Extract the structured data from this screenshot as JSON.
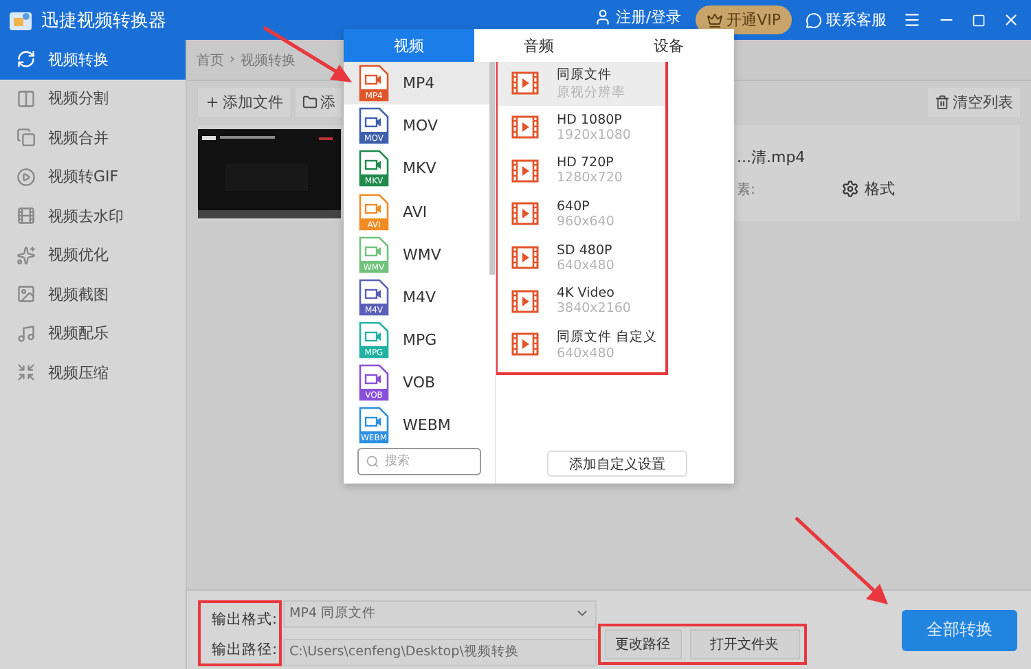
{
  "window": {
    "title": "迅捷视频转换器"
  },
  "header_actions": {
    "login": "注册/登录",
    "vip": "开通VIP",
    "support": "联系客服"
  },
  "sidebar": {
    "items": [
      {
        "label": "视频转换",
        "selected": true
      },
      {
        "label": "视频分割",
        "selected": false
      },
      {
        "label": "视频合并",
        "selected": false
      },
      {
        "label": "视频转GIF",
        "selected": false
      },
      {
        "label": "视频去水印",
        "selected": false
      },
      {
        "label": "视频优化",
        "selected": false
      },
      {
        "label": "视频截图",
        "selected": false
      },
      {
        "label": "视频配乐",
        "selected": false
      },
      {
        "label": "视频压缩",
        "selected": false
      }
    ]
  },
  "breadcrumb": [
    "首页",
    "视频转换"
  ],
  "breadcrumb_separator": "›",
  "toolbar": {
    "add_file": "添加文件",
    "add_folder": "添",
    "clear": "清空列表"
  },
  "file": {
    "name": "...清.mp4",
    "info": "素:",
    "format": "格式"
  },
  "format_popup": {
    "tabs": [
      {
        "label": "视频",
        "selected": true
      },
      {
        "label": "音频",
        "selected": false
      },
      {
        "label": "设备",
        "selected": false
      }
    ],
    "formats": [
      {
        "label": "MP4",
        "badge": "MP4",
        "color": "#e0562b",
        "selected": true
      },
      {
        "label": "MOV",
        "badge": "MOV",
        "color": "#3d5fae",
        "selected": false
      },
      {
        "label": "MKV",
        "badge": "MKV",
        "color": "#1f8a4c",
        "selected": false
      },
      {
        "label": "AVI",
        "badge": "AVI",
        "color": "#f08c24",
        "selected": false
      },
      {
        "label": "WMV",
        "badge": "WMV",
        "color": "#70c27c",
        "selected": false
      },
      {
        "label": "M4V",
        "badge": "M4V",
        "color": "#5b5fb9",
        "selected": false
      },
      {
        "label": "MPG",
        "badge": "MPG",
        "color": "#21b2a2",
        "selected": false
      },
      {
        "label": "VOB",
        "badge": "VOB",
        "color": "#8a4fd8",
        "selected": false
      },
      {
        "label": "WEBM",
        "badge": "WEBM",
        "color": "#2d8fe0",
        "selected": false
      }
    ],
    "search": {
      "placeholder": "搜索"
    },
    "presets": [
      {
        "title": "同原文件",
        "subtitle": "原视分辨率",
        "selected": true
      },
      {
        "title": "HD 1080P",
        "subtitle": "1920x1080",
        "selected": false
      },
      {
        "title": "HD 720P",
        "subtitle": "1280x720",
        "selected": false
      },
      {
        "title": "640P",
        "subtitle": "960x640",
        "selected": false
      },
      {
        "title": "SD 480P",
        "subtitle": "640x480",
        "selected": false
      },
      {
        "title": "4K Video",
        "subtitle": "3840x2160",
        "selected": false
      },
      {
        "title": "同原文件 自定义",
        "subtitle": "640x480",
        "selected": false
      }
    ],
    "add_custom": "添加自定义设置"
  },
  "output": {
    "format_label": "输出格式:",
    "format_value": "MP4  同原文件",
    "path_label": "输出路径:",
    "path_value": "C:\\Users\\cenfeng\\Desktop\\视频转换",
    "change_path": "更改路径",
    "open_folder": "打开文件夹",
    "convert_all": "全部转换"
  }
}
